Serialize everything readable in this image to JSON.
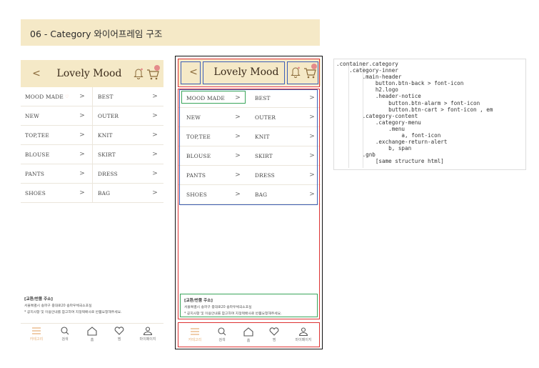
{
  "banner": {
    "title": "06 - Category 와이어프레임 구조"
  },
  "header": {
    "back_icon": "<",
    "logo": "Lovely Mood"
  },
  "menu": {
    "rows": [
      {
        "left": "MOOD MADE",
        "right": "BEST"
      },
      {
        "left": "NEW",
        "right": "OUTER"
      },
      {
        "left": "TOP,TEE",
        "right": "KNIT"
      },
      {
        "left": "BLOUSE",
        "right": "SKIRT"
      },
      {
        "left": "PANTS",
        "right": "DRESS"
      },
      {
        "left": "SHOES",
        "right": "BAG"
      }
    ],
    "arrow": ">"
  },
  "notice": {
    "title": "[교환/반품 주소]",
    "line1": "서울특별시 송파구 중대로20 송파우체국소포실",
    "line2": "* 공지사항 및 이용안내를 참고하여 지정택배사로 반품요청해주세요."
  },
  "gnb": {
    "items": [
      {
        "label": "카테고리",
        "icon": "menu-icon"
      },
      {
        "label": "검색",
        "icon": "search-icon"
      },
      {
        "label": "홈",
        "icon": "home-icon"
      },
      {
        "label": "찜",
        "icon": "heart-icon"
      },
      {
        "label": "마이페이지",
        "icon": "user-icon"
      }
    ]
  },
  "colors": {
    "header_bg": "#f5e9c7",
    "accent": "#e7b17b",
    "annotation_red": "#d33333",
    "annotation_blue": "#3d5fb8",
    "annotation_green": "#3aa55a"
  },
  "code": {
    "lines": [
      ".container.category",
      "    .category-inner",
      "        .main-header",
      "            button.btn-back > font-icon",
      "            h2.logo",
      "            .header-notice",
      "                button.btn-alarm > font-icon",
      "                button.btn-cart > font-icon , em",
      "        .category-content",
      "            .category-menu",
      "                .menu",
      "                    a, font-icon",
      "            .exchange-return-alert",
      "                b, span",
      "        .gnb",
      "            [same structure html]"
    ]
  }
}
